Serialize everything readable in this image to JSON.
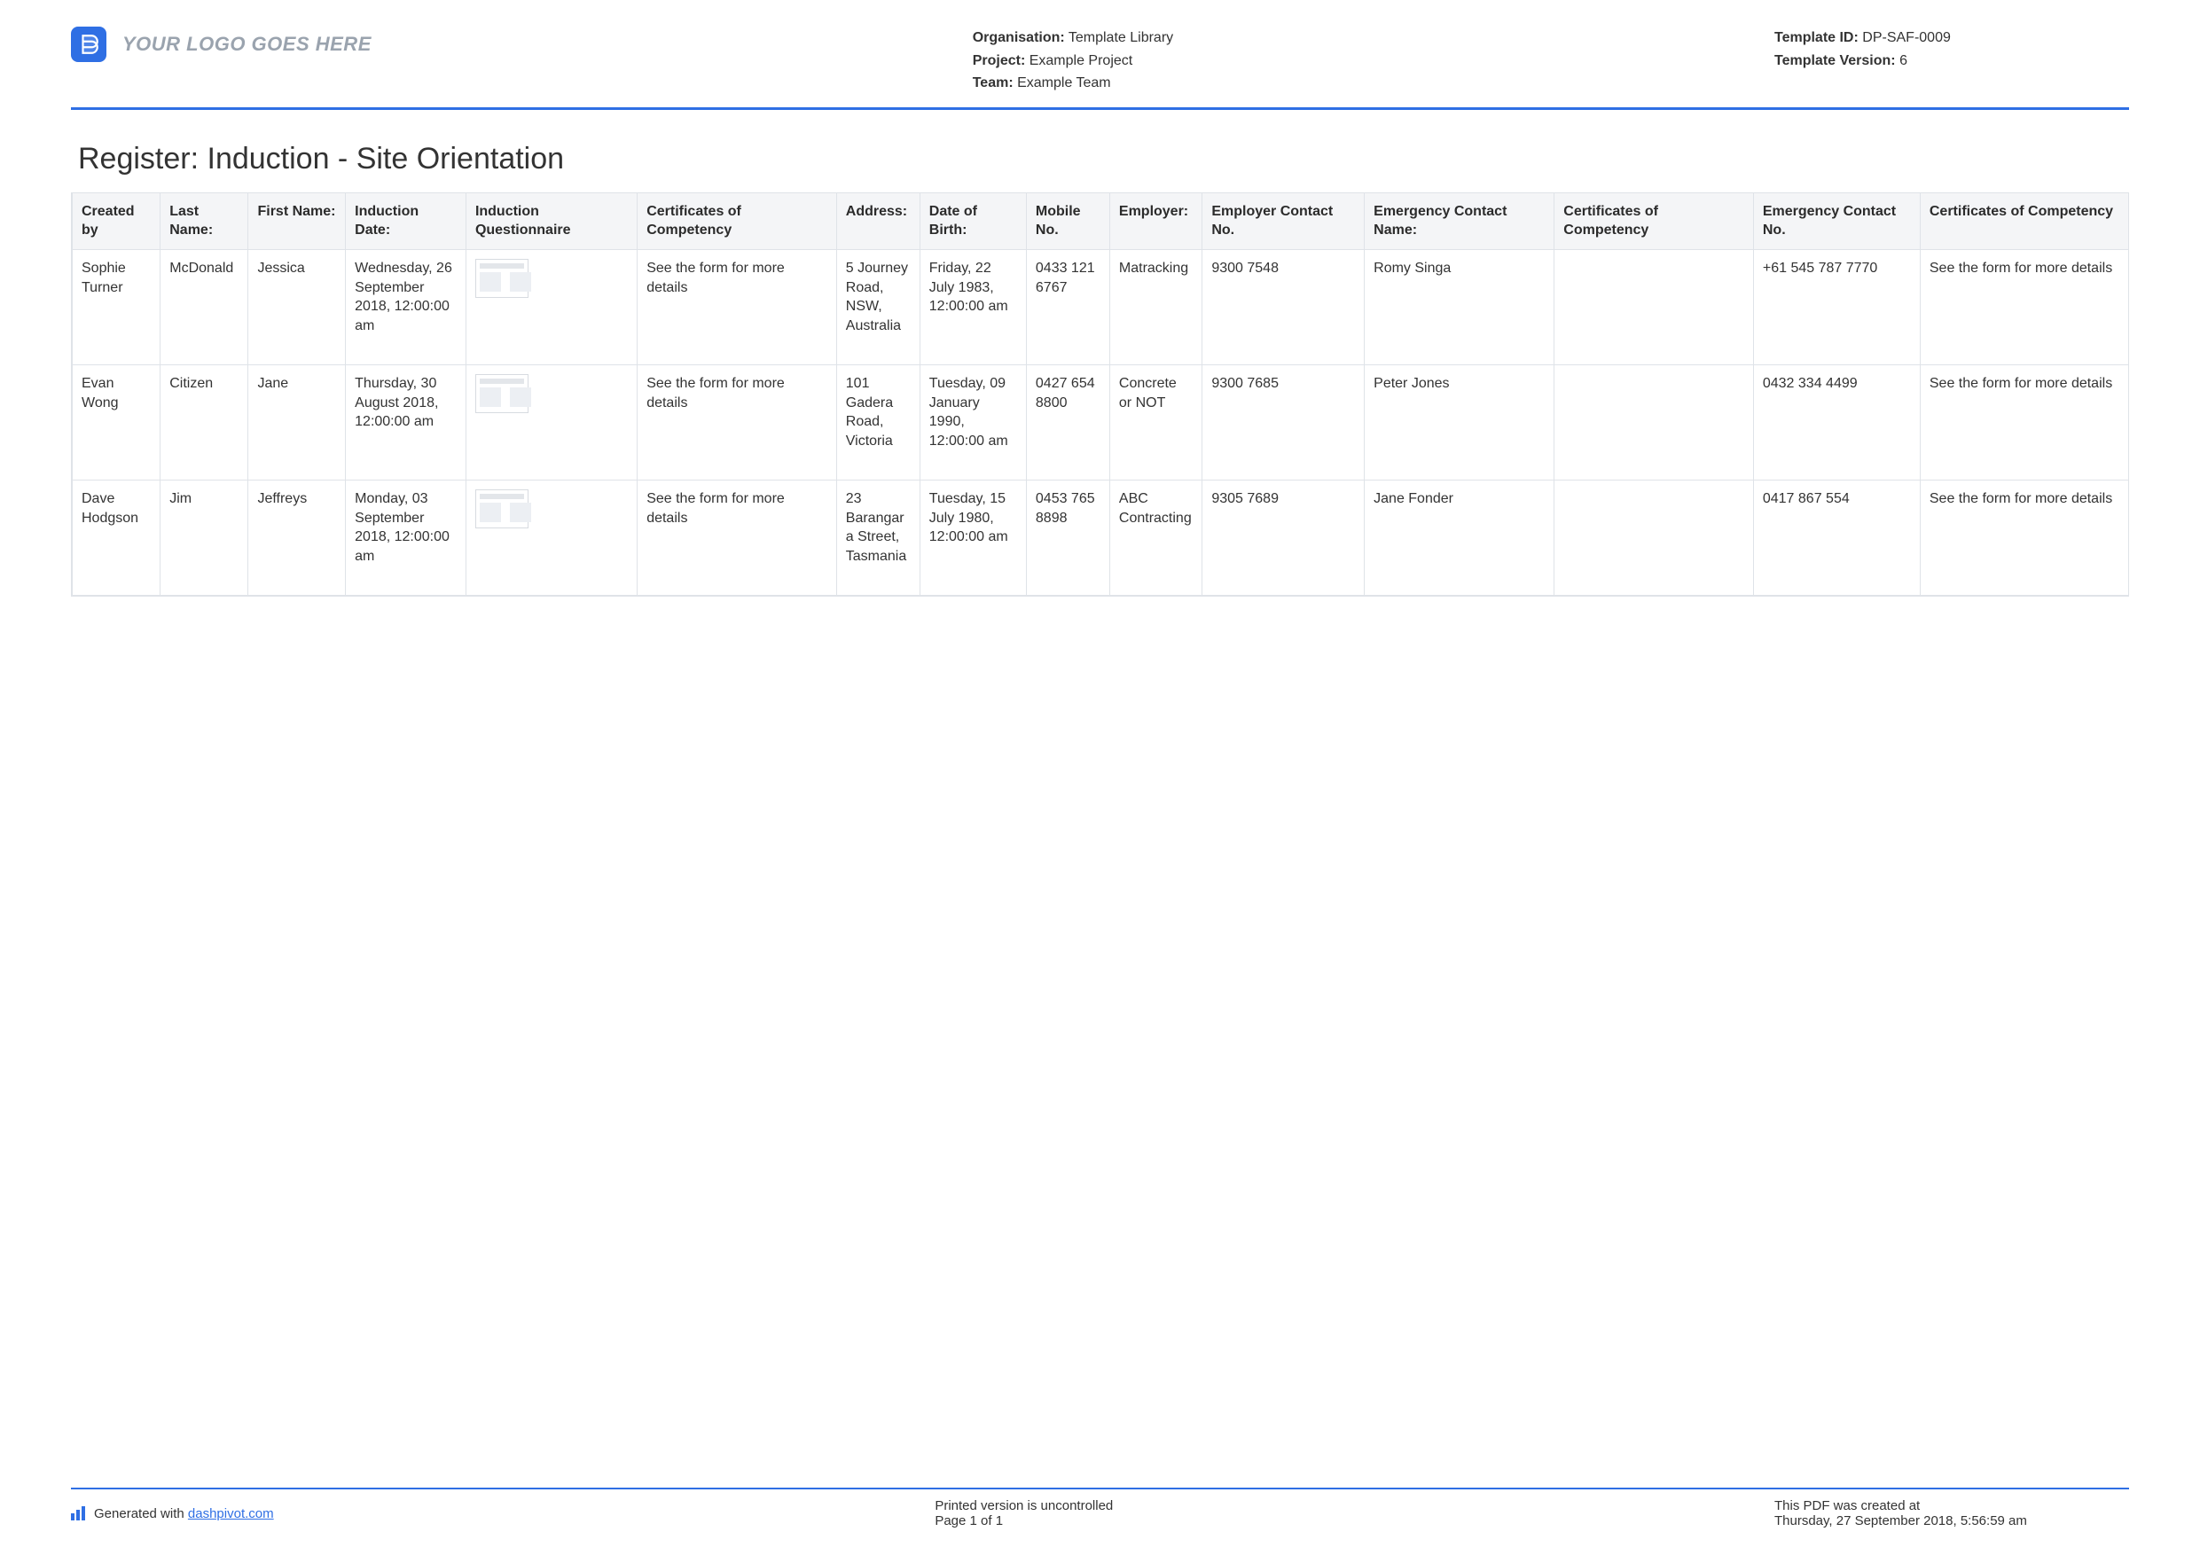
{
  "header": {
    "logo_text": "YOUR LOGO GOES HERE",
    "org_label": "Organisation:",
    "org_value": "Template Library",
    "project_label": "Project:",
    "project_value": "Example Project",
    "team_label": "Team:",
    "team_value": "Example Team",
    "template_id_label": "Template ID:",
    "template_id_value": "DP-SAF-0009",
    "template_version_label": "Template Version:",
    "template_version_value": "6"
  },
  "title": "Register: Induction - Site Orientation",
  "columns": {
    "created_by": "Created by",
    "last_name": "Last Name:",
    "first_name": "First Name:",
    "induction_date": "Induction Date:",
    "questionnaire": "Induction Questionnaire",
    "cert1": "Certificates of Competency",
    "address": "Address:",
    "dob": "Date of Birth:",
    "mobile": "Mobile No.",
    "employer": "Employer:",
    "employer_contact": "Employer Contact No.",
    "em_name": "Emergency Contact Name:",
    "cert2": "Certificates of Competency",
    "em_no": "Emergency Contact No.",
    "cert3": "Certificates of Competency"
  },
  "rows": [
    {
      "created_by": "Sophie Turner",
      "last_name": "McDonald",
      "first_name": "Jessica",
      "induction_date": "Wednesday, 26 September 2018, 12:00:00 am",
      "cert1": "See the form for more details",
      "address": "5 Journey Road, NSW, Australia",
      "dob": "Friday, 22 July 1983, 12:00:00 am",
      "mobile": "0433 121 6767",
      "employer": "Matracking",
      "employer_contact": "9300 7548",
      "em_name": "Romy Singa",
      "cert2": "",
      "em_no": "+61 545 787 7770",
      "cert3": "See the form for more details"
    },
    {
      "created_by": "Evan Wong",
      "last_name": "Citizen",
      "first_name": "Jane",
      "induction_date": "Thursday, 30 August 2018, 12:00:00 am",
      "cert1": "See the form for more details",
      "address": "101 Gadera Road, Victoria",
      "dob": "Tuesday, 09 January 1990, 12:00:00 am",
      "mobile": "0427 654 8800",
      "employer": "Concrete or NOT",
      "employer_contact": "9300 7685",
      "em_name": "Peter Jones",
      "cert2": "",
      "em_no": "0432 334 4499",
      "cert3": "See the form for more details"
    },
    {
      "created_by": "Dave Hodgson",
      "last_name": "Jim",
      "first_name": "Jeffreys",
      "induction_date": "Monday, 03 September 2018, 12:00:00 am",
      "cert1": "See the form for more details",
      "address": "23 Barangara Street, Tasmania",
      "dob": "Tuesday, 15 July 1980, 12:00:00 am",
      "mobile": "0453 765 8898",
      "employer": "ABC Contracting",
      "employer_contact": "9305 7689",
      "em_name": "Jane Fonder",
      "cert2": "",
      "em_no": "0417 867 554",
      "cert3": "See the form for more details"
    }
  ],
  "footer": {
    "gen_prefix": "Generated with ",
    "gen_link_text": "dashpivot.com",
    "uncontrolled": "Printed version is uncontrolled",
    "page": "Page 1 of 1",
    "created_label": "This PDF was created at",
    "created_value": "Thursday, 27 September 2018, 5:56:59 am"
  }
}
